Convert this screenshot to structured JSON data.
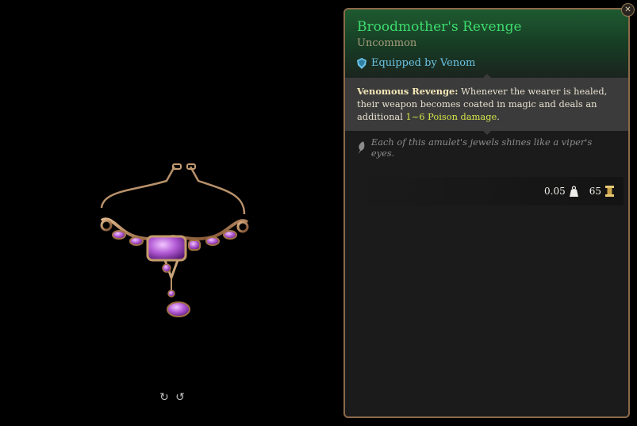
{
  "preview": {
    "rotate_left_icon": "rotate-left-icon",
    "rotate_right_icon": "rotate-right-icon",
    "rotate_left_glyph": "↻",
    "rotate_right_glyph": "↺"
  },
  "tooltip": {
    "title": "Broodmother's Revenge",
    "rarity": "Uncommon",
    "equipped_by": "Equipped by Venom",
    "passive": {
      "name": "Venomous Revenge:",
      "text_before": " Whenever the wearer is healed, their weapon becomes coated in magic and deals an additional ",
      "damage": "1~6 Poison damage",
      "text_after": "."
    },
    "flavor": "Each of this amulet's jewels shines like a viper's eyes.",
    "weight": "0.05",
    "value": "65"
  },
  "close_glyph": "✕",
  "colors": {
    "title": "#3ddc6e",
    "rarity": "#a79e7c",
    "equipped": "#6cc3e6",
    "damage": "#d4e44a",
    "border": "#8c6a4a"
  }
}
